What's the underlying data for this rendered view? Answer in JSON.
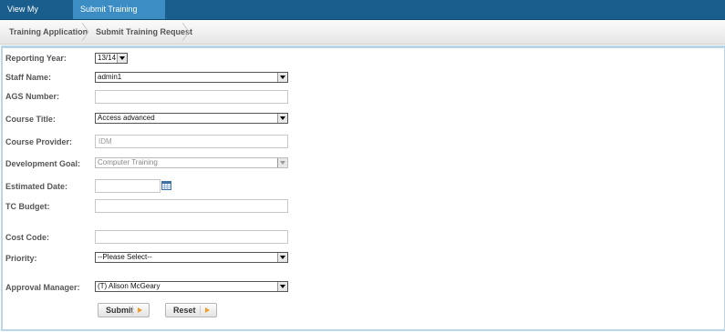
{
  "nav": {
    "tabs": [
      "View My Request",
      "Submit Training Request"
    ]
  },
  "breadcrumb": [
    "Training Application",
    "Submit Training Request"
  ],
  "form": {
    "reporting_year": {
      "label": "Reporting Year:",
      "value": "13/14"
    },
    "staff_name": {
      "label": "Staff Name:",
      "value": "admin1"
    },
    "ags_number": {
      "label": "AGS Number:",
      "value": ""
    },
    "course_title": {
      "label": "Course Title:",
      "value": "Access advanced"
    },
    "course_provider": {
      "label": "Course Provider:",
      "value": "IDM"
    },
    "development_goal": {
      "label": "Development Goal:",
      "value": "Computer Training"
    },
    "estimated_date": {
      "label": "Estimated Date:",
      "value": ""
    },
    "tc_budget": {
      "label": "TC Budget:",
      "value": ""
    },
    "cost_code": {
      "label": "Cost Code:",
      "value": ""
    },
    "priority": {
      "label": "Priority:",
      "value": "--Please Select--"
    },
    "approval_manager": {
      "label": "Approval Manager:",
      "value": "(T) Alison McGeary"
    }
  },
  "buttons": {
    "submit": "Submit",
    "reset": "Reset"
  },
  "icons": {
    "calendar": "calendar-icon",
    "arrow": "orange-play-arrow"
  },
  "colors": {
    "topbar": "#1a5e8d",
    "active_tab": "#3c8dc4",
    "panel_border": "#b9d6e8",
    "accent": "#f39b22"
  }
}
